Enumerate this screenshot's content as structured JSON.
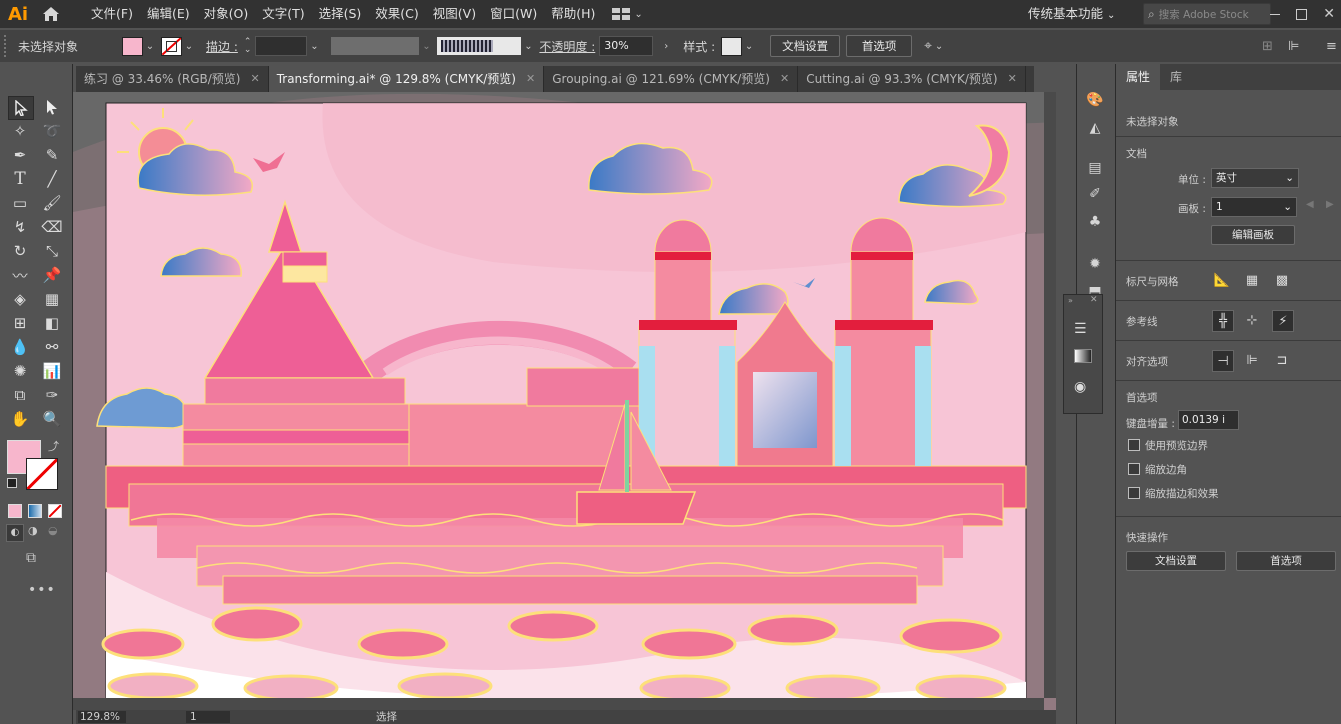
{
  "app": {
    "logo": "Ai",
    "workspace": "传统基本功能",
    "stock_placeholder": "搜索 Adobe Stock"
  },
  "menu": [
    "文件(F)",
    "编辑(E)",
    "对象(O)",
    "文字(T)",
    "选择(S)",
    "效果(C)",
    "视图(V)",
    "窗口(W)",
    "帮助(H)"
  ],
  "control": {
    "selection_status": "未选择对象",
    "fill_color": "#f7b6cc",
    "stroke_label": "描边 :",
    "opacity_label": "不透明度 :",
    "opacity_value": "30%",
    "style_label": "样式 :",
    "doc_settings": "文档设置",
    "preferences": "首选项"
  },
  "tabs": [
    {
      "label": "练习 @ 33.46% (RGB/预览)",
      "active": false
    },
    {
      "label": "Transforming.ai* @ 129.8% (CMYK/预览)",
      "active": true
    },
    {
      "label": "Grouping.ai @ 121.69% (CMYK/预览)",
      "active": false
    },
    {
      "label": "Cutting.ai @ 93.3% (CMYK/预览)",
      "active": false
    }
  ],
  "properties": {
    "tab_properties": "属性",
    "tab_library": "库",
    "no_selection": "未选择对象",
    "doc_section": "文档",
    "unit_label": "单位 :",
    "unit_value": "英寸",
    "artboard_label": "画板 :",
    "artboard_value": "1",
    "edit_artboards": "编辑画板",
    "rulers_grids": "标尺与网格",
    "guides": "参考线",
    "align_options": "对齐选项",
    "preferences_section": "首选项",
    "keyboard_increment_label": "键盘增量 :",
    "keyboard_increment_value": "0.0139 i",
    "use_preview_bounds": "使用预览边界",
    "scale_corners": "缩放边角",
    "scale_strokes": "缩放描边和效果",
    "quick_actions": "快速操作",
    "qa_doc_settings": "文档设置",
    "qa_preferences": "首选项"
  },
  "status": {
    "zoom": "129.8%",
    "artboard": "1",
    "tool": "选择"
  },
  "colors": {
    "accent": "#ff9a00",
    "canvas_pink": "#f7c5d6",
    "hot_pink": "#ef5a8a"
  }
}
